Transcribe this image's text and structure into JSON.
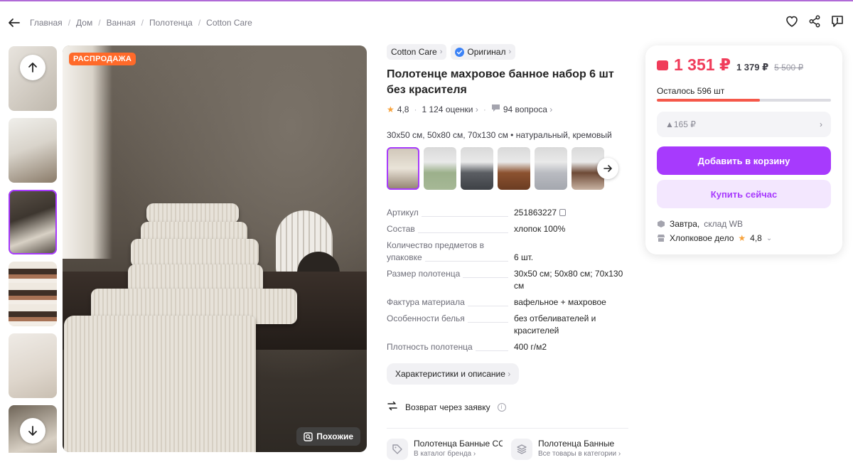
{
  "breadcrumb": [
    "Главная",
    "Дом",
    "Ванная",
    "Полотенца",
    "Cotton Care"
  ],
  "gallery": {
    "sale_badge": "РАСПРОДАЖА",
    "similar_label": "Похожие"
  },
  "product": {
    "brand": "Cotton Care",
    "original_label": "Оригинал",
    "title": "Полотенце махровое банное набор 6 шт без красителя",
    "rating": "4,8",
    "reviews": "1 124 оценки",
    "questions": "94 вопроса",
    "variant_text": "30x50 см, 50x80 см, 70x130 см • натуральный, кремовый"
  },
  "specs": [
    {
      "key": "Артикул",
      "value": "251863227"
    },
    {
      "key": "Состав",
      "value": "хлопок 100%"
    },
    {
      "key": "Количество предметов в упаковке",
      "value": "6 шт."
    },
    {
      "key": "Размер полотенца",
      "value": "30x50 см; 50x80 см; 70x130 см"
    },
    {
      "key": "Фактура материала",
      "value": "вафельное + махровое"
    },
    {
      "key": "Особенности белья",
      "value": "без отбеливателей и красителей"
    },
    {
      "key": "Плотность полотенца",
      "value": "400 г/м2"
    }
  ],
  "char_button": "Характеристики и описание",
  "return_text": "Возврат через заявку",
  "bottom_links": [
    {
      "title": "Полотенца Банные COTTON",
      "sub": "В каталог бренда"
    },
    {
      "title": "Полотенца Банные",
      "sub": "Все товары в категории"
    }
  ],
  "buy_panel": {
    "price": "1 351 ₽",
    "price_old": "1 379 ₽",
    "price_original": "5 500 ₽",
    "stock_text": "Осталось 596 шт",
    "stock_fill_fraction": 0.59,
    "installment": "▲165 ₽",
    "add_to_cart": "Добавить в корзину",
    "buy_now": "Купить сейчас",
    "delivery_day": "Завтра,",
    "delivery_warehouse": "склад WB",
    "seller_name": "Хлопковое дело",
    "seller_rating": "4,8"
  },
  "colors": {
    "accent": "#a73afd",
    "price": "#f03c5a",
    "sale_badge": "#ff6a2a"
  }
}
